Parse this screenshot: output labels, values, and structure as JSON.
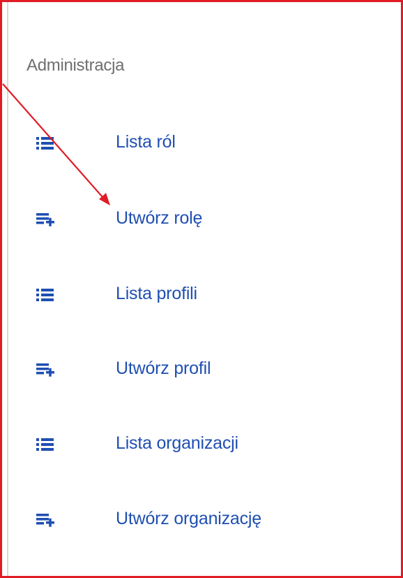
{
  "section": {
    "title": "Administracja"
  },
  "menu": {
    "items": [
      {
        "label": "Lista ról",
        "icon": "list-icon"
      },
      {
        "label": "Utwórz rolę",
        "icon": "playlist-add-icon"
      },
      {
        "label": "Lista profili",
        "icon": "list-icon"
      },
      {
        "label": "Utwórz profil",
        "icon": "playlist-add-icon"
      },
      {
        "label": "Lista organizacji",
        "icon": "list-icon"
      },
      {
        "label": "Utwórz organizację",
        "icon": "playlist-add-icon"
      }
    ]
  },
  "colors": {
    "frame": "#e01b24",
    "link": "#1f4fb2",
    "icon": "#1f4fb2",
    "section_title": "#6f6f6f",
    "annotation_arrow": "#e01b24"
  }
}
